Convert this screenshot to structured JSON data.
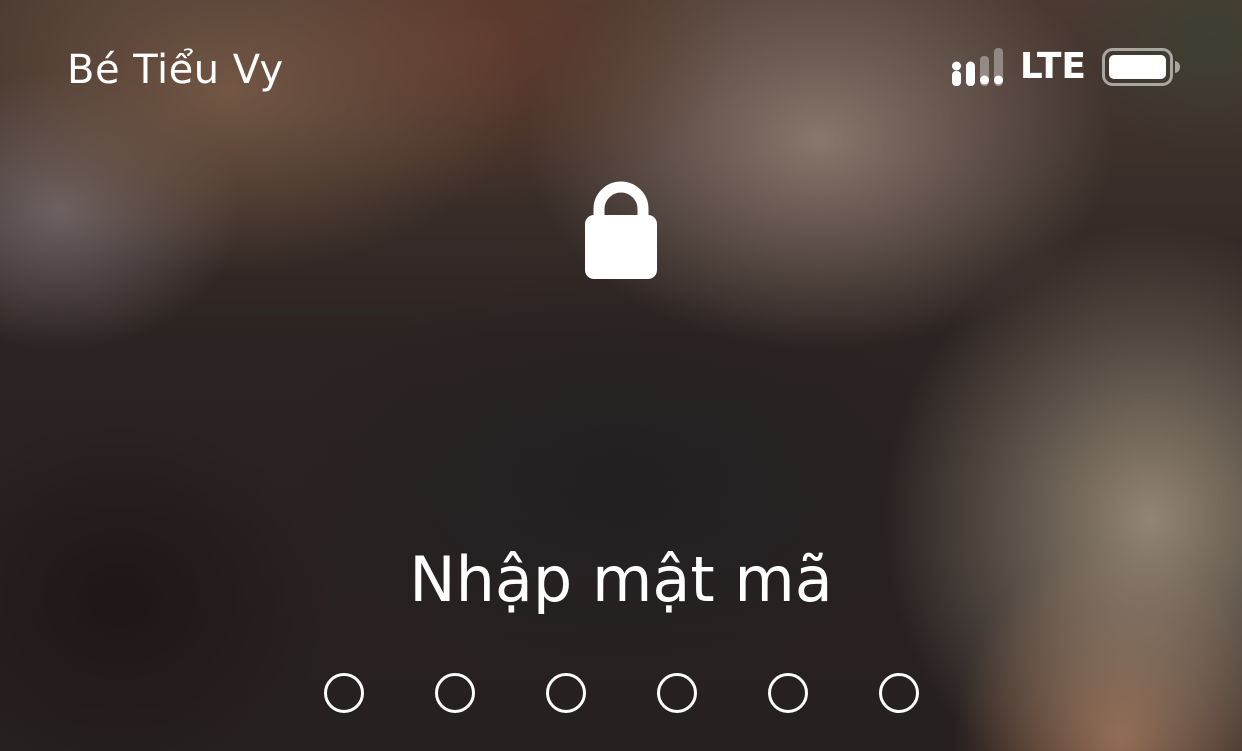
{
  "status_bar": {
    "carrier": "Bé Tiểu Vy",
    "signal_icon": "signal-strength-icon",
    "signal_bars_active": 2,
    "signal_bars_total": 4,
    "network": "LTE",
    "battery_icon": "battery-icon",
    "battery_level": 1.0
  },
  "lock_icon": "padlock-icon",
  "prompt": "Nhập mật mã",
  "passcode": {
    "length": 6,
    "entered": 0
  },
  "colors": {
    "text": "#ffffff"
  }
}
